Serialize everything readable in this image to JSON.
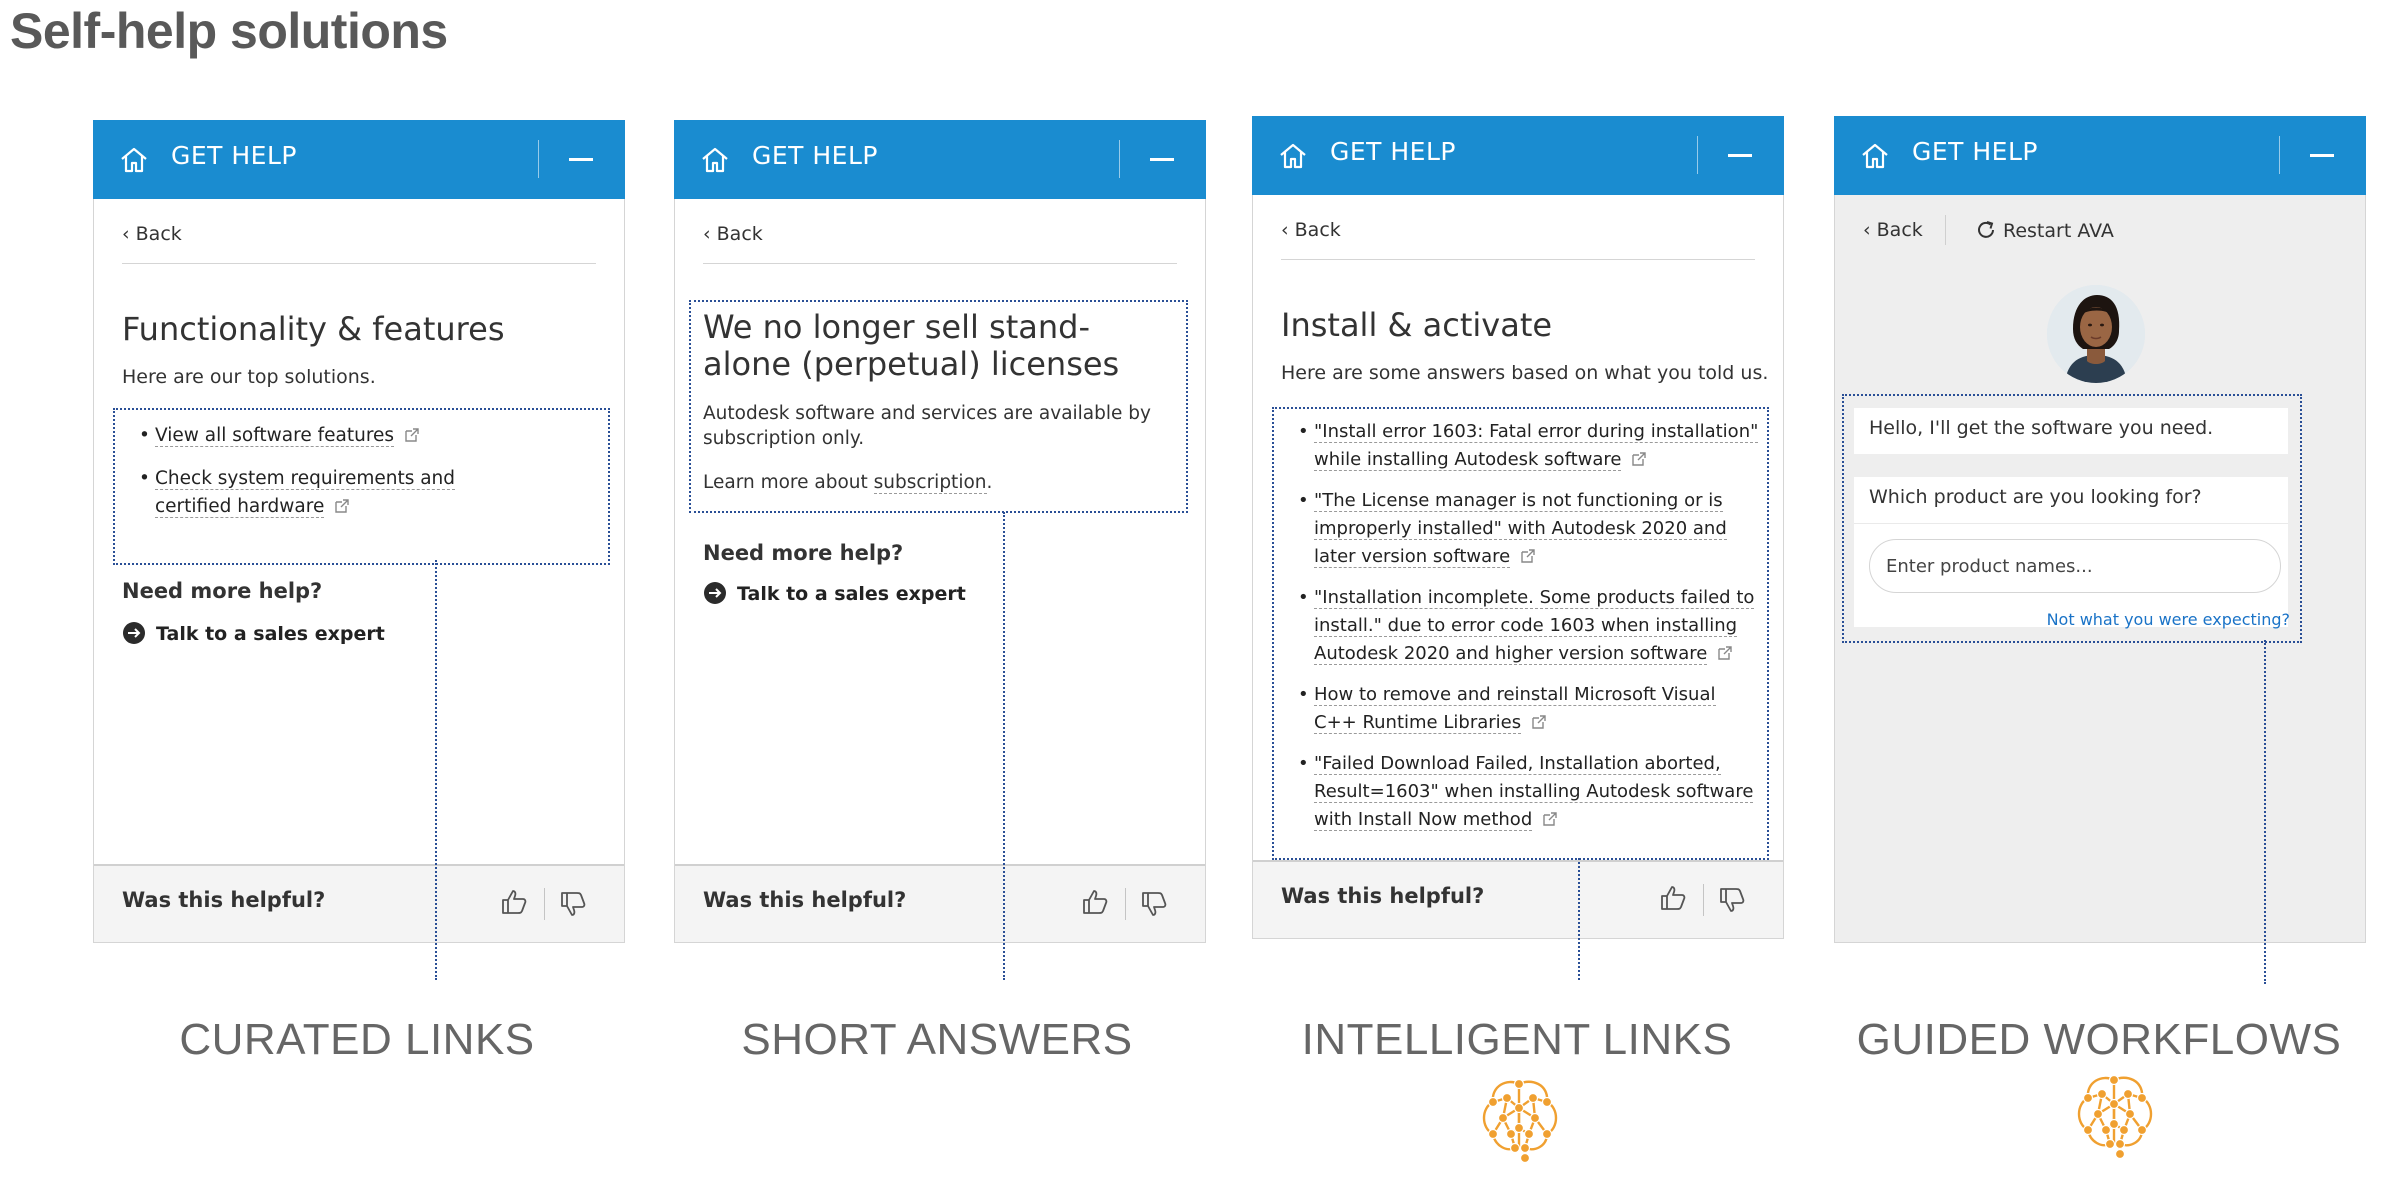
{
  "page_title": "Self-help solutions",
  "brand_color": "#1a8cd0",
  "panels": {
    "curated": {
      "header_title": "GET HELP",
      "back": "Back",
      "title": "Functionality & features",
      "subtitle": "Here are our top solutions.",
      "links": [
        "View all software features",
        "Check system requirements and certified hardware"
      ],
      "more_help": "Need more help?",
      "talk": "Talk to a sales expert",
      "footer_question": "Was this helpful?"
    },
    "short": {
      "header_title": "GET HELP",
      "back": "Back",
      "title": "We no longer sell stand-alone (perpetual) licenses",
      "body": "Autodesk software and services are available by subscription only.",
      "learn_prefix": "Learn more about ",
      "learn_link": "subscription",
      "learn_suffix": ".",
      "more_help": "Need more help?",
      "talk": "Talk to a sales expert",
      "footer_question": "Was this helpful?"
    },
    "intelligent": {
      "header_title": "GET HELP",
      "back": "Back",
      "title": "Install & activate",
      "subtitle": "Here are some answers based on what you told us.",
      "links": [
        "\"Install error 1603: Fatal error during installation\" while installing Autodesk software",
        "\"The License manager is not functioning or is improperly installed\" with Autodesk 2020 and later version software",
        "\"Installation incomplete. Some products failed to install.\" due to error code 1603 when installing Autodesk 2020 and higher version software",
        "How to remove and reinstall Microsoft Visual C++ Runtime Libraries",
        "\"Failed Download Failed, Installation aborted, Result=1603\" when installing Autodesk software with Install Now method"
      ],
      "footer_question": "Was this helpful?"
    },
    "guided": {
      "header_title": "GET HELP",
      "back": "Back",
      "restart": "Restart AVA",
      "greeting": "Hello, I'll get the software you need.",
      "question": "Which product are you looking for?",
      "input_placeholder": "Enter product names...",
      "not_expected": "Not what you were expecting?"
    }
  },
  "captions": [
    "CURATED LINKS",
    "SHORT ANSWERS",
    "INTELLIGENT LINKS",
    "GUIDED WORKFLOWS"
  ],
  "icons": {
    "home": "home-icon",
    "minimize": "minimize-icon",
    "external": "external-link-icon",
    "arrow": "arrow-right-circle-icon",
    "thumb_up": "thumb-up-icon",
    "thumb_down": "thumb-down-icon",
    "restart": "restart-icon",
    "brain": "brain-network-icon"
  },
  "colors": {
    "header": "#1a8cd0",
    "highlight_border": "#2a4f96",
    "brain": "#f0a030",
    "link_blue": "#1a73c7"
  }
}
